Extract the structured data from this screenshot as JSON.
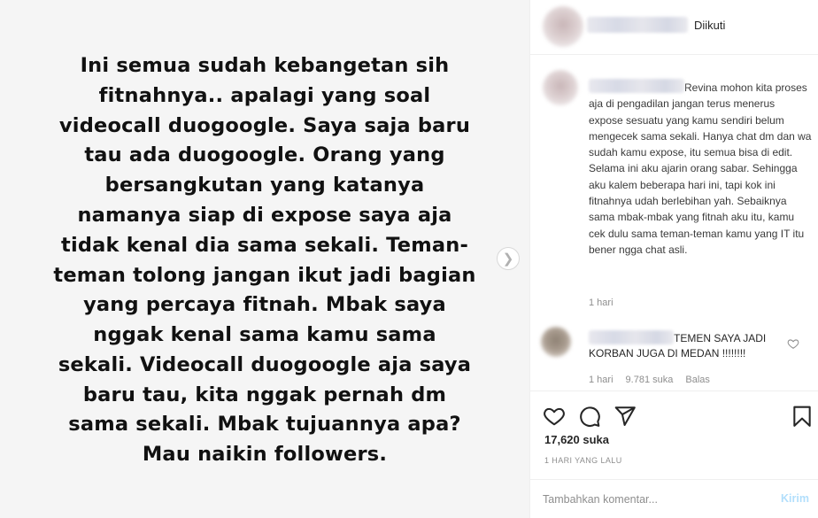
{
  "post": {
    "image_text": "Ini semua sudah kebangetan sih\nfitnahnya.. apalagi yang soal\nvideocall duogoogle. Saya saja baru\ntau ada duogoogle. Orang yang\nbersangkutan yang katanya\nnamanya siap di expose saya aja\ntidak kenal dia sama sekali. Teman-\nteman tolong jangan ikut jadi bagian\nyang percaya fitnah. Mbak saya\nnggak kenal sama kamu sama\nsekali. Videocall duogoogle aja saya\nbaru tau, kita nggak pernah dm\nsama sekali. Mbak tujuannya apa?\nMau naikin followers.",
    "next_icon": "chevron-right-icon"
  },
  "header": {
    "follow_label": "Diikuti"
  },
  "caption": {
    "text": "Revina mohon kita proses aja di pengadilan jangan terus menerus expose sesuatu yang kamu sendiri belum mengecek sama sekali. Hanya chat dm dan wa sudah kamu expose, itu semua bisa di edit. Selama ini aku ajarin orang sabar. Sehingga aku kalem beberapa hari ini, tapi kok ini fitnahnya udah berlebihan yah. Sebaiknya sama mbak-mbak yang fitnah aku itu, kamu cek dulu sama teman-teman kamu yang IT itu bener ngga chat asli.",
    "time": "1 hari"
  },
  "comment": {
    "text": "TEMEN SAYA JADI KORBAN JUGA DI MEDAN !!!!!!!!",
    "time": "1 hari",
    "likes": "9.781 suka",
    "reply": "Balas"
  },
  "actions": {
    "likes": "17,620 suka",
    "date": "1 HARI YANG LALU"
  },
  "comment_box": {
    "placeholder": "Tambahkan komentar...",
    "post_label": "Kirim"
  },
  "colors": {
    "border": "#efefef",
    "muted": "#8e8e8e",
    "post_button_disabled": "#b2dffc",
    "image_bg": "#f5f5f5"
  }
}
